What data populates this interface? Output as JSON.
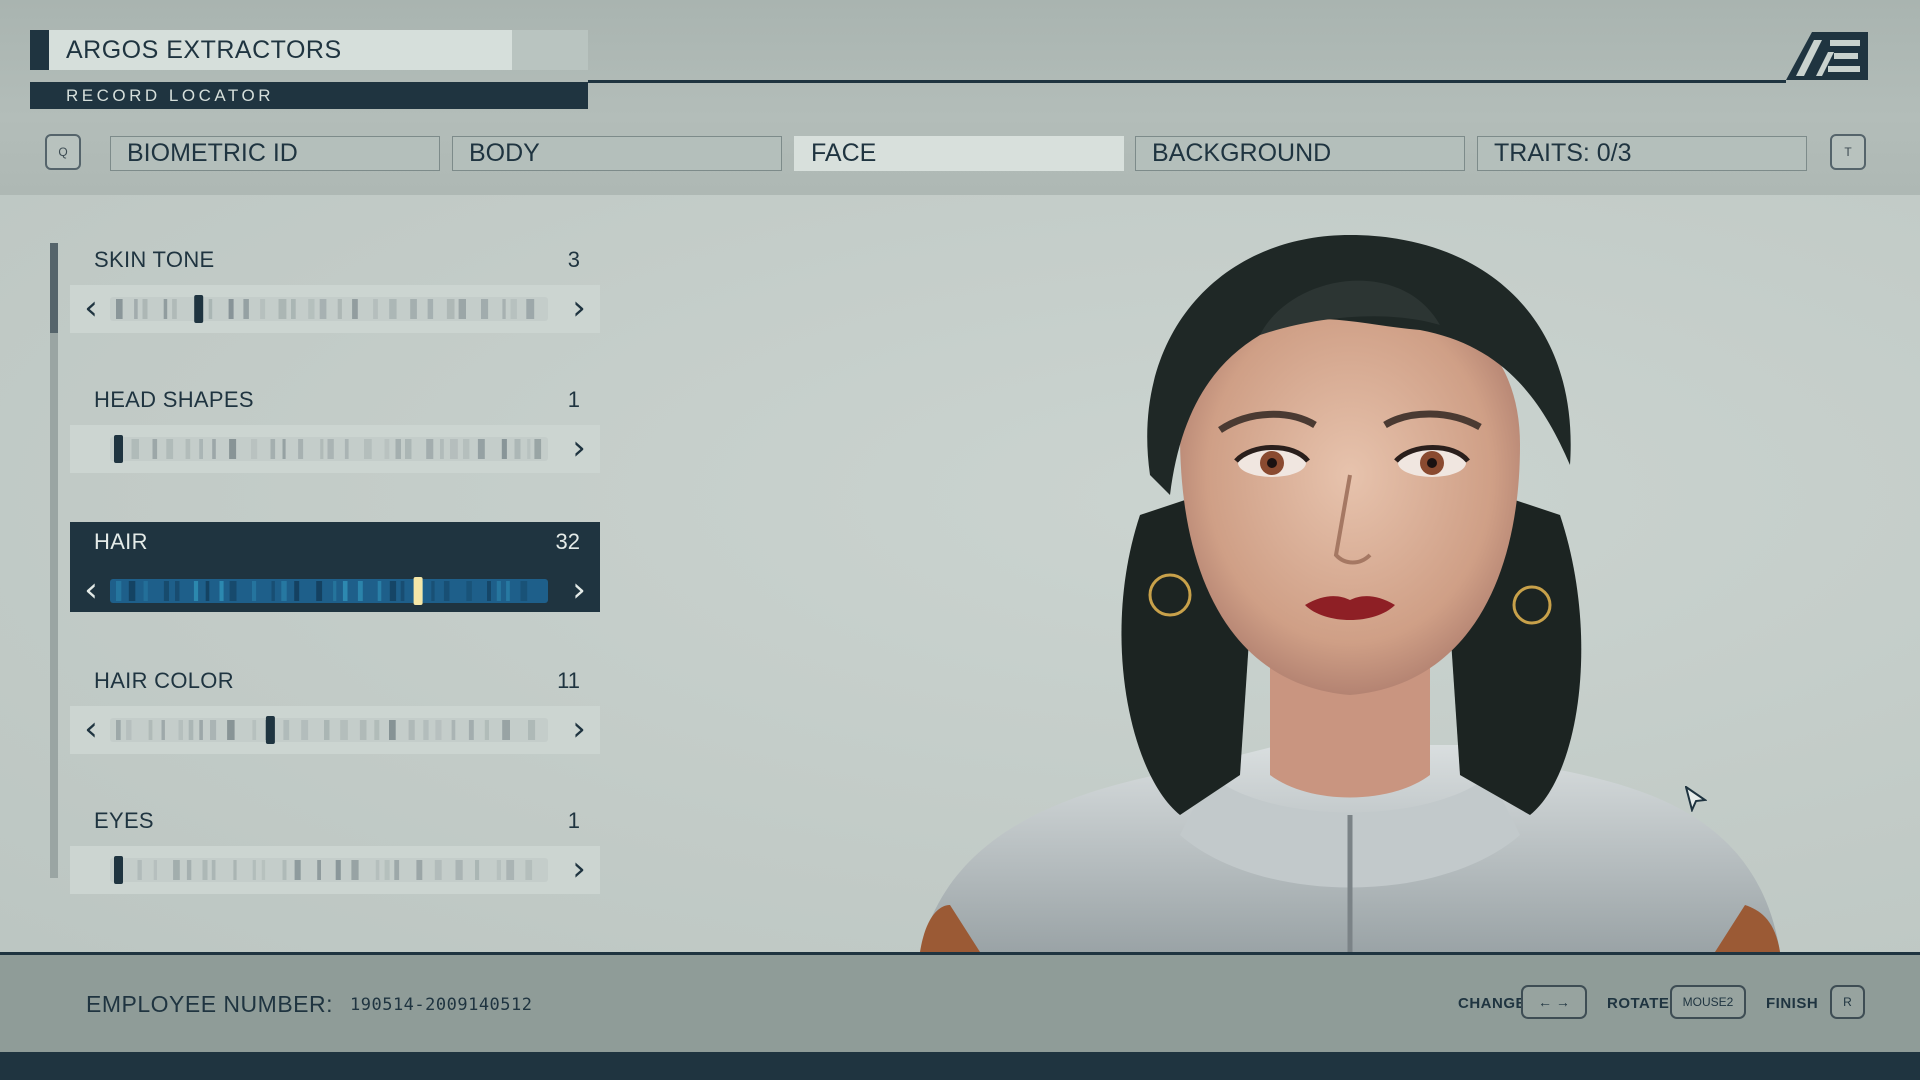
{
  "header": {
    "company_name": "ARGOS EXTRACTORS",
    "record_locator": "RECORD LOCATOR",
    "logo_icon": "ae-logo-icon",
    "prev_tab_key": "Q",
    "next_tab_key": "T"
  },
  "tabs": [
    {
      "label": "BIOMETRIC ID",
      "active": false
    },
    {
      "label": "BODY",
      "active": false
    },
    {
      "label": "FACE",
      "active": true
    },
    {
      "label": "BACKGROUND",
      "active": false
    },
    {
      "label": "TRAITS: 0/3",
      "active": false
    }
  ],
  "face_options": [
    {
      "label": "SKIN TONE",
      "value": "3",
      "position": 0.19
    },
    {
      "label": "HEAD SHAPES",
      "value": "1",
      "position": 0.0
    },
    {
      "label": "HAIR",
      "value": "32",
      "position": 0.71,
      "selected": true
    },
    {
      "label": "HAIR COLOR",
      "value": "11",
      "position": 0.36
    },
    {
      "label": "EYES",
      "value": "1",
      "position": 0.0
    }
  ],
  "footer": {
    "employee_label": "EMPLOYEE NUMBER:",
    "employee_number": "190514-2009140512",
    "change_label": "CHANGE",
    "change_key": "← →",
    "rotate_label": "ROTATE",
    "rotate_key": "MOUSE2",
    "finish_label": "FINISH",
    "finish_key": "R"
  },
  "colors": {
    "primary_dark": "#1f3440",
    "panel_light": "#d8e0dc",
    "background": "#c3ccc8",
    "highlight_marker": "#f5e7a8",
    "selected_strip": "#1e5f8a"
  }
}
